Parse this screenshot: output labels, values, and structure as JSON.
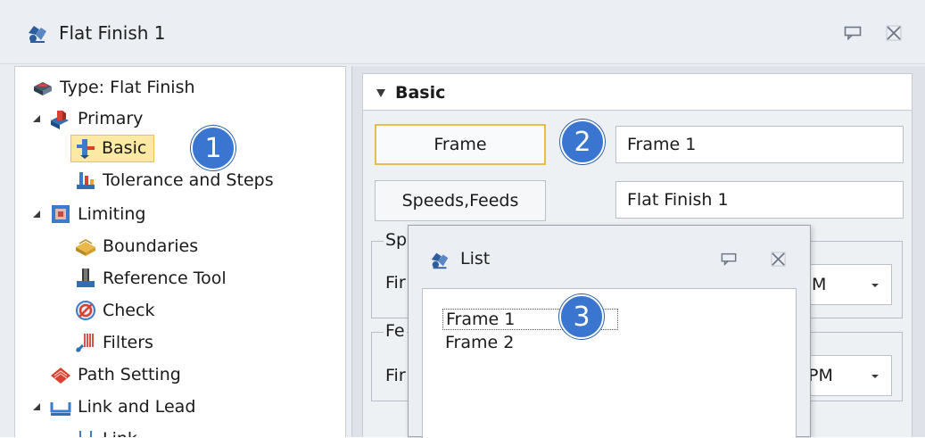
{
  "window": {
    "title": "Flat Finish 1",
    "icon": "operation-icon",
    "buttons": [
      "pin-icon",
      "close-icon"
    ]
  },
  "tree": {
    "items": [
      {
        "label": "Type: Flat Finish",
        "icon": "type-icon",
        "expander": "none"
      },
      {
        "label": "Primary",
        "icon": "primary-icon",
        "expander": "expanded"
      },
      {
        "label": "Basic",
        "icon": "basic-icon",
        "expander": "none",
        "selected": true
      },
      {
        "label": "Tolerance and Steps",
        "icon": "tolerance-icon",
        "expander": "none"
      },
      {
        "label": "Limiting",
        "icon": "limiting-icon",
        "expander": "expanded"
      },
      {
        "label": "Boundaries",
        "icon": "boundaries-icon",
        "expander": "none"
      },
      {
        "label": "Reference Tool",
        "icon": "reference-tool-icon",
        "expander": "none"
      },
      {
        "label": "Check",
        "icon": "check-icon",
        "expander": "none"
      },
      {
        "label": "Filters",
        "icon": "filters-icon",
        "expander": "none"
      },
      {
        "label": "Path Setting",
        "icon": "path-setting-icon",
        "expander": "none"
      },
      {
        "label": "Link and Lead",
        "icon": "link-lead-icon",
        "expander": "expanded"
      },
      {
        "label": "Link",
        "icon": "link-icon",
        "expander": "none"
      }
    ]
  },
  "badges": {
    "one": "1",
    "two": "2",
    "three": "3"
  },
  "panel": {
    "section_title": "Basic",
    "frame_button": "Frame",
    "frame_value": "Frame 1",
    "speeds_button": "Speeds,Feeds",
    "speeds_value": "Flat Finish 1",
    "group1_title": "Sp",
    "group1_row_label": "Fir",
    "group1_combo_value": "M",
    "group2_title": "Fe",
    "group2_row_label": "Fir",
    "group2_combo_value": "PM"
  },
  "list_dialog": {
    "title": "List",
    "items": [
      "Frame 1",
      "Frame 2"
    ]
  },
  "colors": {
    "selection_fill": "#fce9a3",
    "selection_border": "#e8bd4e",
    "badge": "#3a76cf"
  }
}
